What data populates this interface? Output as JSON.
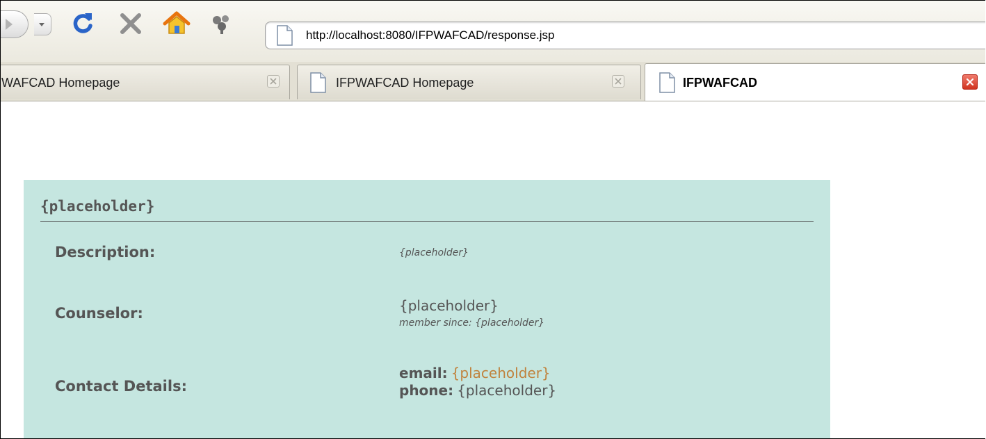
{
  "browser": {
    "address_bar": {
      "url": "http://localhost:8080/IFPWAFCAD/response.jsp"
    },
    "tabs": [
      {
        "label": "WAFCAD Homepage",
        "active": false
      },
      {
        "label": "IFPWAFCAD Homepage",
        "active": false
      },
      {
        "label": "IFPWAFCAD",
        "active": true
      }
    ],
    "icons": {
      "back": "back-arrow-icon",
      "history": "history-dropdown-icon",
      "reload": "reload-icon",
      "stop": "stop-icon",
      "home": "home-icon",
      "addon": "addon-icon",
      "page": "page-icon",
      "close_tab": "close-tab-icon"
    },
    "colors": {
      "reload": "#2a64c8",
      "stop": "#8f8f8f",
      "home_roof": "#e8740e",
      "home_body": "#f5c32c"
    }
  },
  "page": {
    "panel_color": "#c5e6e0",
    "title": "{placeholder}",
    "description": {
      "label": "Description:",
      "value": "{placeholder}"
    },
    "counselor": {
      "label": "Counselor:",
      "name": "{placeholder}",
      "member_since": "member since: {placeholder}"
    },
    "contact": {
      "label": "Contact Details:",
      "email_label": "email:",
      "email": "{placeholder}",
      "phone_label": "phone:",
      "phone": "{placeholder}"
    },
    "link_color": "#c0833e",
    "text_color": "#555555"
  }
}
